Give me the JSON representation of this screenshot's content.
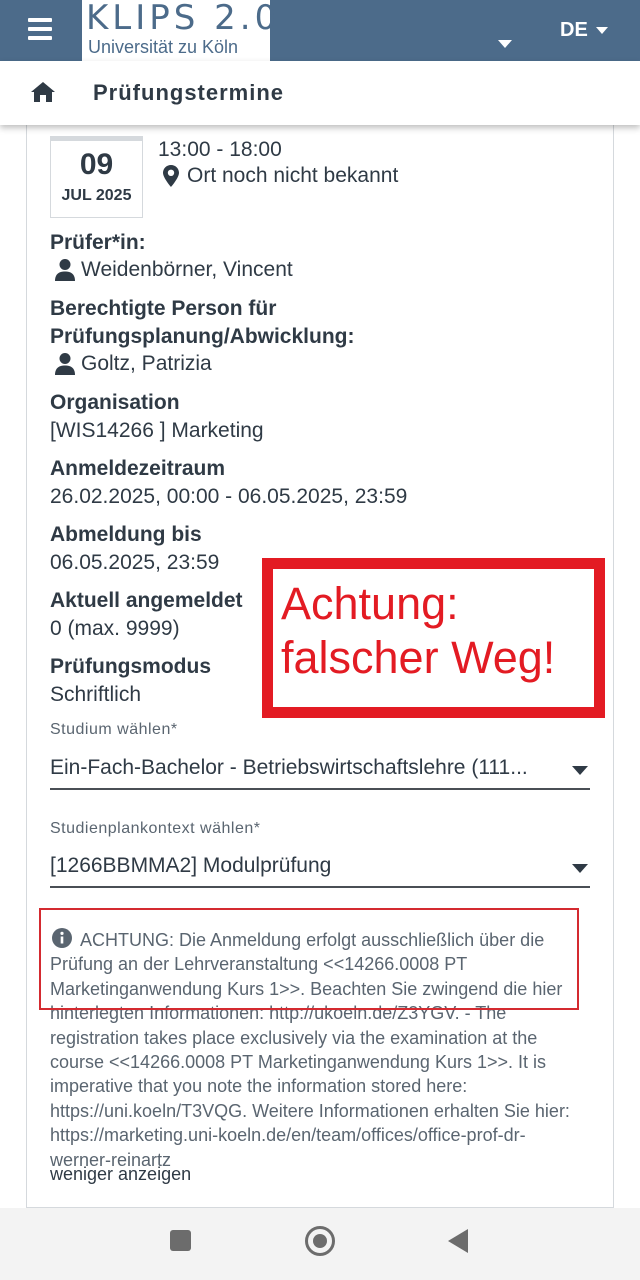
{
  "header": {
    "logo_title": "KLIPS 2.0",
    "logo_subtitle": "Universität zu Köln",
    "language": "DE"
  },
  "subheader": {
    "title": "Prüfungstermine"
  },
  "exam": {
    "date_day": "09",
    "date_month": "JUL 2025",
    "time": "13:00 - 18:00",
    "location": "Ort noch nicht bekannt",
    "examiner_label": "Prüfer*in:",
    "examiner_name": "Weidenbörner, Vincent",
    "planner_label_line1": "Berechtigte Person für",
    "planner_label_line2": "Prüfungsplanung/Abwicklung:",
    "planner_name": "Goltz, Patrizia",
    "organisation_label": "Organisation",
    "organisation_value": "[WIS14266 ] Marketing",
    "registration_period_label": "Anmeldezeitraum",
    "registration_period_value": "26.02.2025, 00:00 - 06.05.2025, 23:59",
    "deregistration_label": "Abmeldung bis",
    "deregistration_value": "06.05.2025, 23:59",
    "registered_label": "Aktuell angemeldet",
    "registered_value": "0 (max. 9999)",
    "mode_label": "Prüfungsmodus",
    "mode_value": "Schriftlich"
  },
  "form": {
    "study_label": "Studium wählen*",
    "study_value": "Ein-Fach-Bachelor - Betriebswirtschaftslehre (111...",
    "context_label": "Studienplankontext wählen*",
    "context_value": "[1266BBMMA2]  Modulprüfung"
  },
  "info": {
    "text": "ACHTUNG: Die Anmeldung erfolgt ausschließlich über die Prüfung an der Lehrveranstaltung <<14266.0008 PT Marketinganwendung Kurs 1>>. Beachten Sie zwingend die hier hinterlegten Informationen: http://ukoeln.de/Z3YGV. - The registration takes place exclusively via the examination at the course <<14266.0008 PT Marketinganwendung Kurs 1>>. It is imperative that you note the information stored here: https://uni.koeln/T3VQG. Weitere Informationen erhalten Sie hier: https://marketing.uni-koeln.de/en/team/offices/office-prof-dr-werner-reinartz",
    "toggle_label": "weniger anzeigen"
  },
  "annotation": {
    "line1": "Achtung:",
    "line2": "falscher Weg!",
    "color": "#e31b23"
  },
  "colors": {
    "header_bg": "#4c6b8a",
    "text": "#2f3a45"
  }
}
